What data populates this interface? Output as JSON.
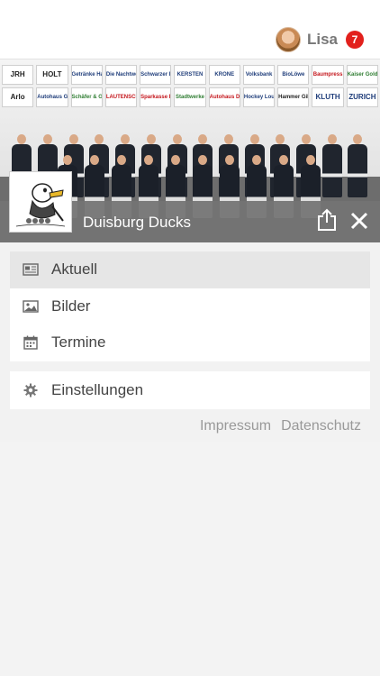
{
  "user": {
    "name": "Lisa",
    "notification_count": "7"
  },
  "hero": {
    "sponsors": [
      "JRH",
      "HOLT",
      "Getränke Hammerschmidt",
      "Die Nachtwelt",
      "Schwarzer Immobilien",
      "KERSTEN",
      "KRONE",
      "Volksbank",
      "BioLöwe",
      "Baumpress",
      "Kaiser Gold",
      "Arlo",
      "Autohaus Goldbeck",
      "Schäfer & Großbecker",
      "LAUTENSCHLÄGER",
      "Sparkasse Duisburg",
      "Stadtwerke",
      "Autohaus Duisburg",
      "Hockey Lounge",
      "Hammer Gilde",
      "KLUTH",
      "ZURICH"
    ]
  },
  "club": {
    "name": "Duisburg Ducks",
    "logo_alt": "Duisburg Ducks logo"
  },
  "menu": {
    "items": [
      {
        "label": "Aktuell",
        "icon": "newspaper-icon"
      },
      {
        "label": "Bilder",
        "icon": "image-icon"
      },
      {
        "label": "Termine",
        "icon": "calendar-icon"
      }
    ],
    "settings": {
      "label": "Einstellungen",
      "icon": "gear-icon"
    }
  },
  "footer": {
    "impressum": "Impressum",
    "datenschutz": "Datenschutz"
  },
  "colors": {
    "badge": "#e2201c",
    "title_bar": "#737373",
    "active_item": "#e6e6e6"
  }
}
